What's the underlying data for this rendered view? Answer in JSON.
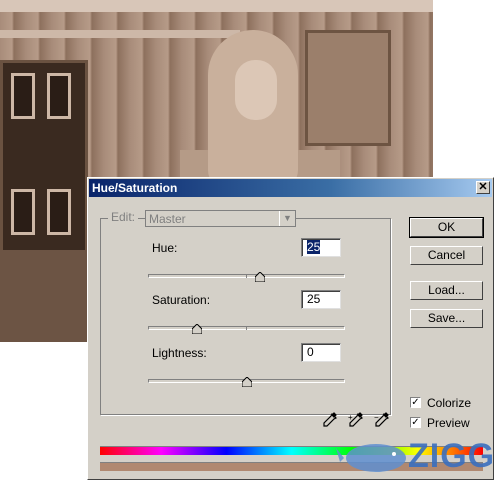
{
  "window": {
    "title": "Hue/Saturation",
    "close_icon": "close-icon"
  },
  "edit": {
    "label": "Edit:",
    "selected": "Master"
  },
  "sliders": {
    "hue": {
      "label": "Hue:",
      "value": "25",
      "min": -180,
      "max": 180
    },
    "saturation": {
      "label": "Saturation:",
      "value": "25",
      "min": 0,
      "max": 100
    },
    "lightness": {
      "label": "Lightness:",
      "value": "0",
      "min": -100,
      "max": 100
    }
  },
  "buttons": {
    "ok": "OK",
    "cancel": "Cancel",
    "load": "Load...",
    "save": "Save..."
  },
  "checkboxes": {
    "colorize": {
      "label": "Colorize",
      "checked": true
    },
    "preview": {
      "label": "Preview",
      "checked": true
    }
  },
  "colors": {
    "titlebar": "#0a246a",
    "dialog_bg": "#d4d0c8",
    "colorized_result": "#b08870"
  },
  "watermark": {
    "text": "ZIGG"
  }
}
